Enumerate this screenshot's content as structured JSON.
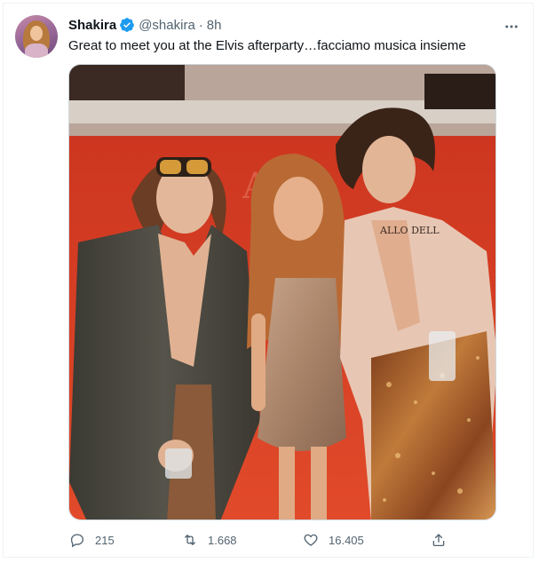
{
  "tweet": {
    "author_name": "Shakira",
    "author_handle": "@shakira",
    "separator": "·",
    "time": "8h",
    "verified": true,
    "text": "Great to meet you at the Elvis afterparty…facciamo musica insieme",
    "media": {
      "tattoo_text": "ALLO DELL"
    }
  },
  "actions": {
    "reply_count": "215",
    "retweet_count": "1.668",
    "like_count": "16.405"
  },
  "icons": {
    "verified": "verified-badge-icon",
    "more": "more-options-icon",
    "reply": "reply-icon",
    "retweet": "retweet-icon",
    "like": "heart-icon",
    "share": "share-icon"
  },
  "colors": {
    "verified": "#1d9bf0",
    "secondary_text": "#536471",
    "primary_text": "#0f1419",
    "background_red": "#d63a24"
  }
}
